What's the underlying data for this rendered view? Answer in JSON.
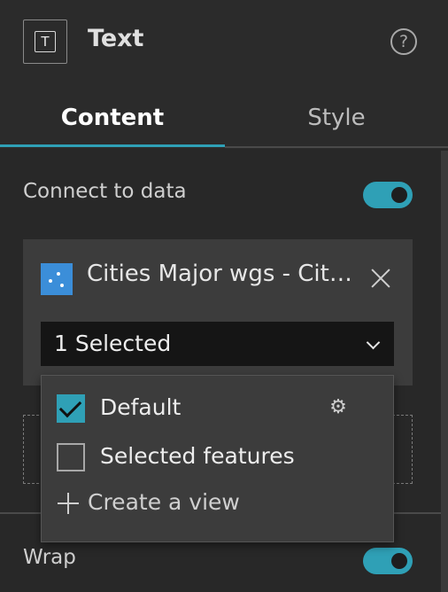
{
  "header": {
    "widget_icon_glyph": "T",
    "title": "Text",
    "help_glyph": "?"
  },
  "tabs": [
    {
      "label": "Content",
      "active": true
    },
    {
      "label": "Style",
      "active": false
    }
  ],
  "connect_to_data": {
    "label": "Connect to data",
    "enabled": true
  },
  "data_source": {
    "name": "Cities Major wgs - Cities Major",
    "icon": "feature-layer-icon",
    "selection_value": "1 Selected"
  },
  "view_dropdown": {
    "items": [
      {
        "label": "Default",
        "checked": true,
        "has_settings": true
      },
      {
        "label": "Selected features",
        "checked": false,
        "has_settings": false
      }
    ],
    "create_label": "Create a view"
  },
  "wrap": {
    "label": "Wrap",
    "enabled": true
  },
  "colors": {
    "accent": "#2fa0b6",
    "background": "#282828",
    "card": "#3c3c3c",
    "datasource_icon": "#3b8ed9"
  }
}
